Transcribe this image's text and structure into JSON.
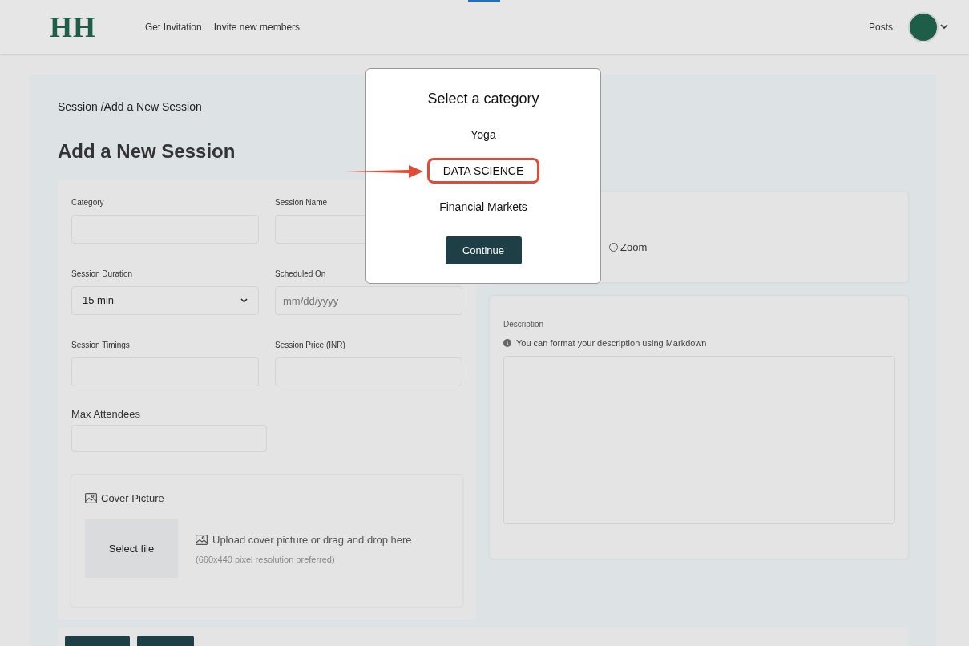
{
  "header": {
    "logo": "HH",
    "nav": [
      "Get Invitation",
      "Invite new members"
    ],
    "right_link": "Posts"
  },
  "breadcrumb": "Session /Add a New Session",
  "heading": "Add a New Session",
  "form": {
    "fields": [
      {
        "kind": "text",
        "label": "Category"
      },
      {
        "kind": "text",
        "label": "Session Name"
      },
      {
        "kind": "select",
        "label": "Session Duration",
        "value": "15 min"
      },
      {
        "kind": "date",
        "label": "Scheduled On",
        "placeholder": "mm/dd/yyyy"
      },
      {
        "kind": "text",
        "label": "Session Timings"
      },
      {
        "kind": "text",
        "label": "Session Price (INR)"
      }
    ],
    "max_attendees": {
      "label": "Max Attendees"
    },
    "cover": {
      "title": "Cover Picture",
      "button": "Select file",
      "hint": "Upload cover picture or drag and drop here",
      "note": "(660x440 pixel resolution preferred)"
    }
  },
  "platform": {
    "options": [
      {
        "label": "Zoom",
        "selected": false
      }
    ]
  },
  "description": {
    "label": "Description",
    "hint": "You can format your description using Markdown"
  },
  "modal": {
    "title": "Select a category",
    "options": [
      {
        "label": "Yoga",
        "highlighted": false
      },
      {
        "label": "DATA SCIENCE",
        "highlighted": true
      },
      {
        "label": "Financial Markets",
        "highlighted": false
      }
    ],
    "button": "Continue"
  }
}
